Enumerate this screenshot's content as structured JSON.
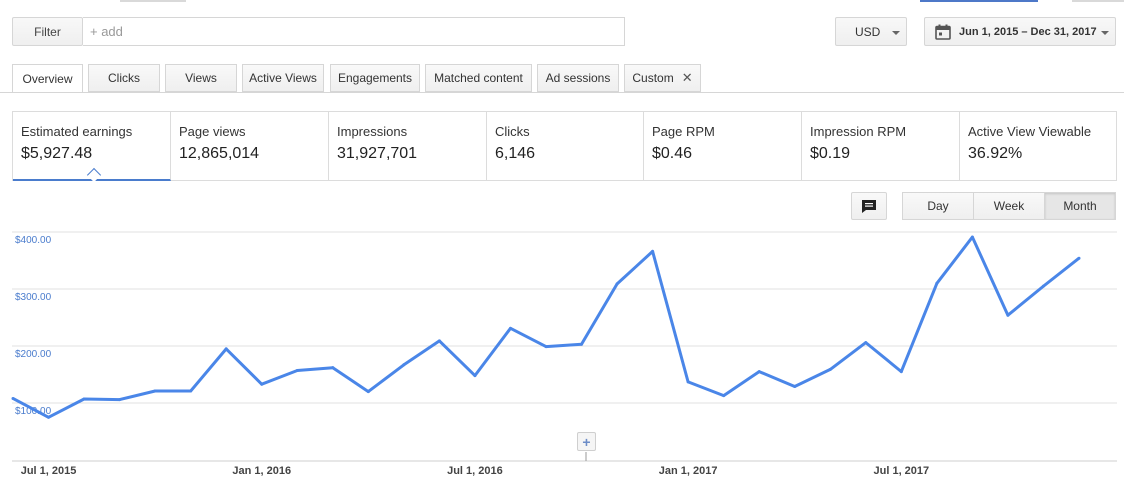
{
  "filter": {
    "label": "Filter",
    "placeholder": "+ add"
  },
  "currency": {
    "value": "USD"
  },
  "date_range": {
    "value": "Jun 1, 2015 – Dec 31, 2017"
  },
  "tabs": [
    {
      "label": "Overview"
    },
    {
      "label": "Clicks"
    },
    {
      "label": "Views"
    },
    {
      "label": "Active Views"
    },
    {
      "label": "Engagements"
    },
    {
      "label": "Matched content"
    },
    {
      "label": "Ad sessions"
    },
    {
      "label": "Custom"
    }
  ],
  "metrics": [
    {
      "label": "Estimated earnings",
      "value": "$5,927.48"
    },
    {
      "label": "Page views",
      "value": "12,865,014"
    },
    {
      "label": "Impressions",
      "value": "31,927,701"
    },
    {
      "label": "Clicks",
      "value": "6,146"
    },
    {
      "label": "Page RPM",
      "value": "$0.46"
    },
    {
      "label": "Impression RPM",
      "value": "$0.19"
    },
    {
      "label": "Active View Viewable",
      "value": "36.92%"
    }
  ],
  "granularity": {
    "options": [
      "Day",
      "Week",
      "Month"
    ],
    "selected": "Month"
  },
  "colors": {
    "accent": "#4a7ccd",
    "line": "#4a86e8",
    "axis_label": "#4a7ccd"
  },
  "icons": {
    "annotation": "comment-icon",
    "calendar": "calendar-icon",
    "add": "plus-icon",
    "close": "close-icon"
  },
  "chart_data": {
    "type": "line",
    "series": [
      {
        "values": [
          {
            "x": "2015-06",
            "y": 108
          },
          {
            "x": "2015-07",
            "y": 75
          },
          {
            "x": "2015-08",
            "y": 107
          },
          {
            "x": "2015-09",
            "y": 106
          },
          {
            "x": "2015-10",
            "y": 121
          },
          {
            "x": "2015-11",
            "y": 121
          },
          {
            "x": "2015-12",
            "y": 195
          },
          {
            "x": "2016-01",
            "y": 133
          },
          {
            "x": "2016-02",
            "y": 157
          },
          {
            "x": "2016-03",
            "y": 162
          },
          {
            "x": "2016-04",
            "y": 120
          },
          {
            "x": "2016-05",
            "y": 167
          },
          {
            "x": "2016-06",
            "y": 209
          },
          {
            "x": "2016-07",
            "y": 148
          },
          {
            "x": "2016-08",
            "y": 231
          },
          {
            "x": "2016-09",
            "y": 199
          },
          {
            "x": "2016-10",
            "y": 203
          },
          {
            "x": "2016-11",
            "y": 309
          },
          {
            "x": "2016-12",
            "y": 366
          },
          {
            "x": "2017-01",
            "y": 137
          },
          {
            "x": "2017-02",
            "y": 113
          },
          {
            "x": "2017-03",
            "y": 155
          },
          {
            "x": "2017-04",
            "y": 129
          },
          {
            "x": "2017-05",
            "y": 159
          },
          {
            "x": "2017-06",
            "y": 206
          },
          {
            "x": "2017-07",
            "y": 155
          },
          {
            "x": "2017-08",
            "y": 310
          },
          {
            "x": "2017-09",
            "y": 391
          },
          {
            "x": "2017-10",
            "y": 254
          },
          {
            "x": "2017-11",
            "y": 305
          },
          {
            "x": "2017-12",
            "y": 354
          }
        ]
      }
    ],
    "y_ticks": [
      "$400.00",
      "$300.00",
      "$200.00",
      "$100.00"
    ],
    "y_tick_values": [
      400,
      300,
      200,
      100
    ],
    "x_ticks": [
      "Jul 1, 2015",
      "Jan 1, 2016",
      "Jul 1, 2016",
      "Jan 1, 2017",
      "Jul 1, 2017"
    ],
    "x_tick_months": [
      "2015-07",
      "2016-01",
      "2016-07",
      "2017-01",
      "2017-07"
    ],
    "grid": true
  }
}
